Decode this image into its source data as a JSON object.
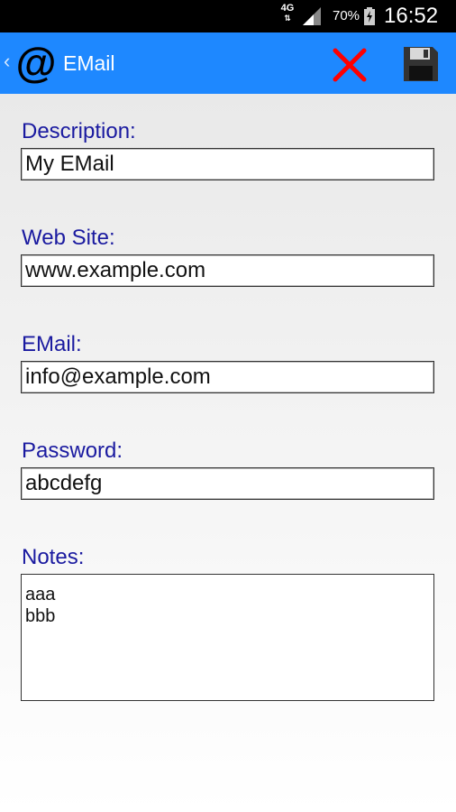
{
  "status_bar": {
    "network": "4G",
    "network_sub": "⇅",
    "battery_percent": "70%",
    "time": "16:52"
  },
  "app_bar": {
    "back_glyph": "‹",
    "logo_glyph": "@",
    "title": "EMail",
    "close_icon": "close-x",
    "save_icon": "floppy-disk"
  },
  "form": {
    "description": {
      "label": "Description:",
      "value": "My EMail"
    },
    "website": {
      "label": "Web Site:",
      "value": "www.example.com"
    },
    "email": {
      "label": "EMail:",
      "value": "info@example.com"
    },
    "password": {
      "label": "Password:",
      "value": "abcdefg"
    },
    "notes": {
      "label": "Notes:",
      "value": "aaa\nbbb"
    }
  },
  "colors": {
    "app_bar": "#1e88ff",
    "label": "#1a1aa0",
    "close": "#ff0000"
  }
}
